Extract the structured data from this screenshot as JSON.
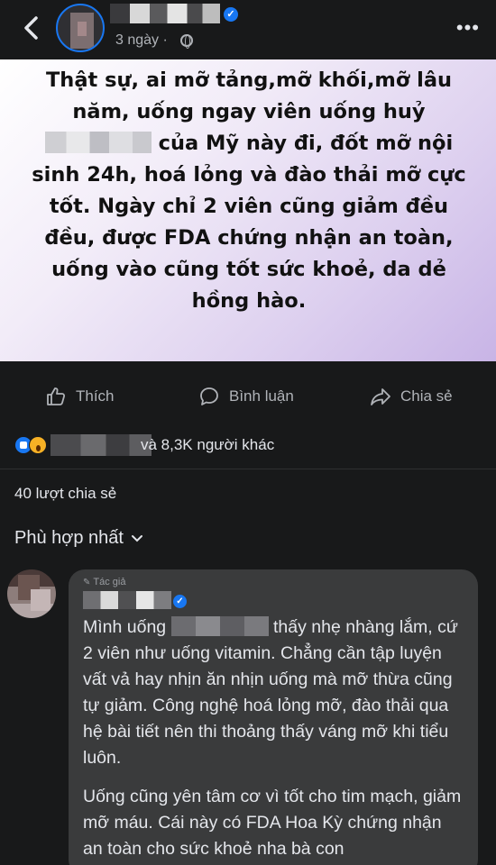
{
  "header": {
    "time": "3 ngày ·",
    "back_icon": "chevron-left-icon",
    "more_icon": "ellipsis-icon",
    "more_label": "•••"
  },
  "post": {
    "text_before_blur": "Thật sự, ai mỡ tảng,mỡ khối,mỡ lâu năm, uống ngay viên uống huỷ",
    "text_after_blur": "của Mỹ này đi, đốt mỡ nội sinh 24h, hoá lỏng và đào thải mỡ cực tốt. Ngày chỉ 2 viên cũng giảm đều đều, được FDA chứng nhận an toàn, uống vào cũng tốt sức khoẻ, da dẻ hồng hào.",
    "colors": {
      "text": "#111111",
      "bg_start": "#ffffff",
      "bg_end": "#c8b4e6"
    }
  },
  "actions": {
    "like": "Thích",
    "comment": "Bình luận",
    "share": "Chia sẻ"
  },
  "reactions": {
    "text": "và 8,3K người khác",
    "icons": [
      "like-reaction-icon",
      "wow-reaction-icon"
    ]
  },
  "shares": {
    "text": "40 lượt chia sẻ"
  },
  "sort": {
    "label": "Phù hợp nhất",
    "chevron": "⌄"
  },
  "comment": {
    "author_badge": "Tác giả",
    "para1_before_blur": "Mình uống",
    "para1_after_blur": "thấy nhẹ nhàng lắm, cứ 2 viên như uống vitamin. Chẳng cần tập luyện vất vả hay nhịn ăn nhịn uống mà mỡ thừa cũng tự giảm. Công nghệ hoá lỏng mỡ, đào thải qua hệ bài tiết nên thi thoảng thấy váng mỡ khi tiểu luôn.",
    "para2": "Uống cũng yên tâm cơ vì tốt cho tim mạch, giảm mỡ máu. Cái này có FDA Hoa Kỳ chứng nhận an toàn cho sức khoẻ nha bà con"
  },
  "theme": {
    "background": "#18191a",
    "accent": "#1877f2",
    "secondary_text": "#b0b3b8",
    "bubble": "#3a3b3c"
  }
}
